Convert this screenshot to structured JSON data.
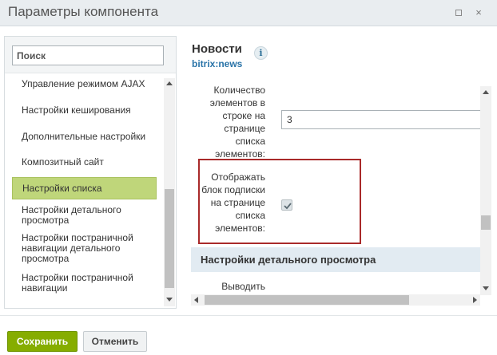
{
  "window": {
    "title": "Параметры компонента",
    "maximize_icon": "maximize-icon",
    "close_icon": "close-icon",
    "close_glyph": "×"
  },
  "sidebar": {
    "search_placeholder": "Поиск",
    "items": [
      {
        "label": "Управление режимом AJAX"
      },
      {
        "label": "Настройки кеширования"
      },
      {
        "label": "Дополнительные настройки"
      },
      {
        "label": "Композитный сайт"
      },
      {
        "label": "Настройки списка",
        "active": true
      },
      {
        "label": "Настройки детального просмотра"
      },
      {
        "label": "Настройки постраничной навигации детального просмотра"
      },
      {
        "label": "Настройки постраничной навигации"
      }
    ]
  },
  "component": {
    "title": "Новости",
    "code": "bitrix:news",
    "info_glyph": "i"
  },
  "params": {
    "count_label": "Количество элементов в строке на странице списка элементов:",
    "count_value": "3",
    "subscribe_label": "Отображать блок подписки на странице списка элементов:",
    "subscribe_checked": true,
    "section_detail": "Настройки детального просмотра",
    "next_label": "Выводить"
  },
  "footer": {
    "save_label": "Сохранить",
    "cancel_label": "Отменить"
  },
  "colors": {
    "active_item": "#bfd67a",
    "save_button": "#86ad00",
    "highlight_border": "#a92a2a",
    "link": "#2a74a8"
  }
}
